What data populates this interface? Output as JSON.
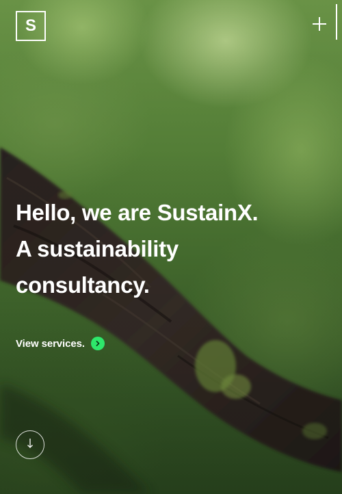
{
  "brand": {
    "logo_letter": "S"
  },
  "hero": {
    "headline_lines": [
      "Hello, we are SustainX.",
      "A sustainability",
      "consultancy."
    ],
    "cta_label": "View services."
  },
  "icons": {
    "menu": "plus-icon",
    "cta": "chevron-right-icon",
    "scroll": "arrow-down-icon"
  },
  "colors": {
    "accent": "#2ee86b",
    "text": "#ffffff"
  }
}
